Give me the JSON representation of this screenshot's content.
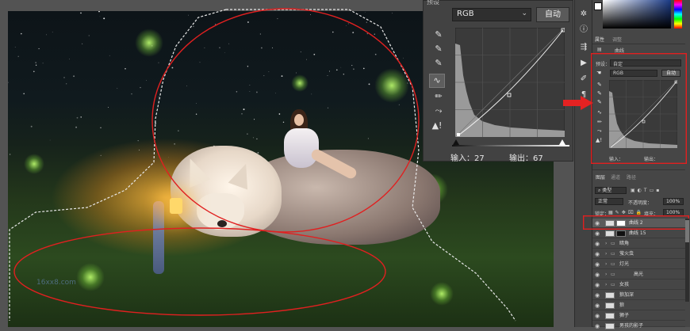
{
  "curves_dialog": {
    "top_label": "预设",
    "channel": "RGB",
    "auto_label": "自动",
    "input_label": "输入：27",
    "output_label": "输出：67",
    "tools": [
      "eyedropper-black",
      "eyedropper-gray",
      "eyedropper-white",
      "curve-point",
      "pencil",
      "smooth",
      "clipping-warning"
    ]
  },
  "properties_panel": {
    "tabs": [
      "属性",
      "调整"
    ],
    "title": "曲线",
    "preset_label": "预设：",
    "preset_value": "自定",
    "channel": "RGB",
    "auto_label": "自动",
    "input_label": "输入：",
    "output_label": "输出："
  },
  "layers_panel": {
    "tabs": [
      "图层",
      "通道",
      "路径"
    ],
    "filter_label": "类型",
    "blend_mode": "正常",
    "opacity_label": "不透明度：",
    "opacity_value": "100%",
    "lock_label": "锁定：",
    "fill_label": "填充：",
    "fill_value": "100%",
    "layers": [
      {
        "name": "曲线 2",
        "type": "adjustment",
        "selected": true
      },
      {
        "name": "曲线 15",
        "type": "adjustment",
        "selected": false
      },
      {
        "name": "暗角",
        "type": "group",
        "selected": false
      },
      {
        "name": "萤火虫",
        "type": "group",
        "selected": false
      },
      {
        "name": "灯光",
        "type": "group",
        "selected": false
      },
      {
        "name": "高光",
        "type": "group",
        "selected": false
      },
      {
        "name": "女孩",
        "type": "group",
        "selected": false
      },
      {
        "name": "狼加深",
        "type": "layer",
        "selected": false
      },
      {
        "name": "狼",
        "type": "layer",
        "selected": false
      },
      {
        "name": "狮子",
        "type": "layer",
        "selected": false
      },
      {
        "name": "男孩的影子",
        "type": "layer",
        "selected": false
      }
    ]
  },
  "canvas": {
    "watermark": "16xx8.com"
  },
  "colors": {
    "annotation_red": "#e02020",
    "panel_bg": "#424242",
    "selected_layer": "#5b5b5b"
  }
}
